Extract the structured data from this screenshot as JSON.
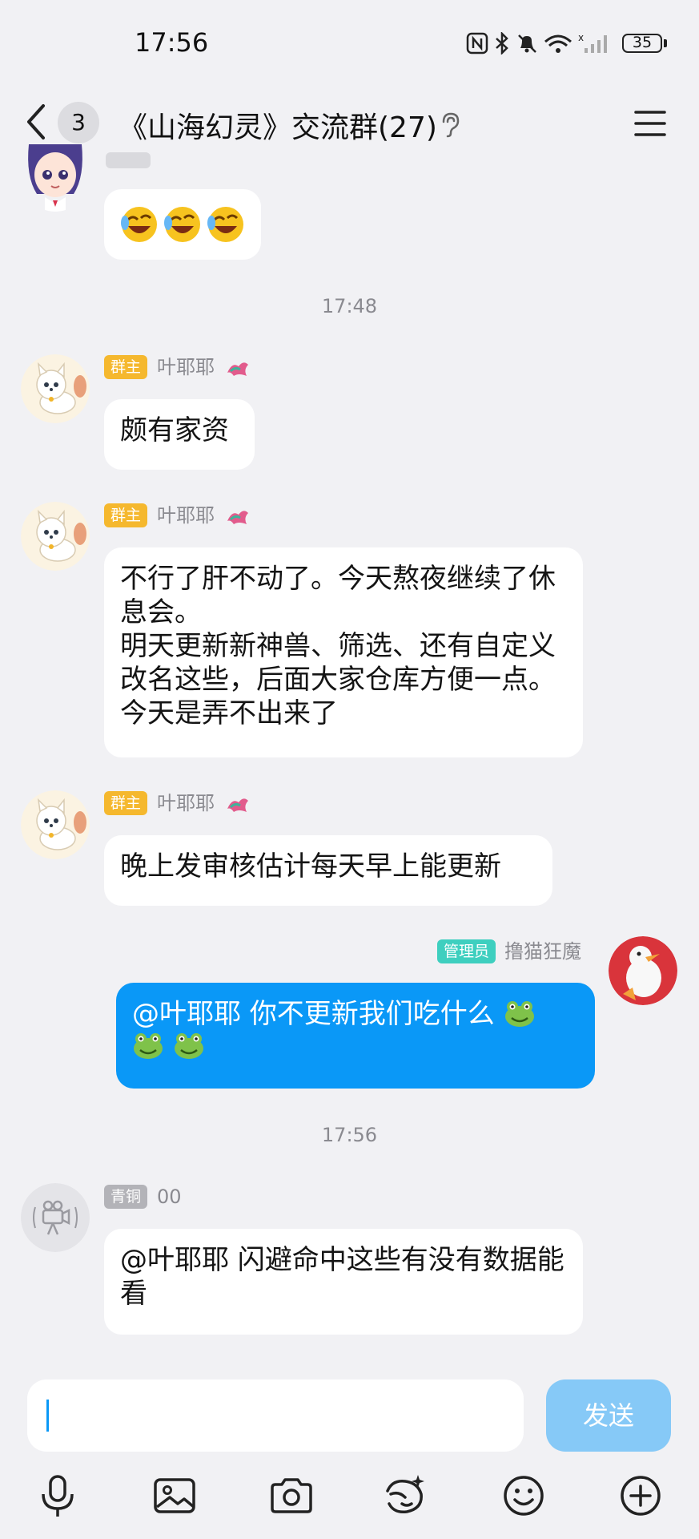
{
  "status_bar": {
    "time": "17:56",
    "battery": "35",
    "icons": [
      "nfc-icon",
      "bluetooth-icon",
      "mute-icon",
      "wifi-icon",
      "signal-icon"
    ]
  },
  "header": {
    "back_icon": "chevron-left-icon",
    "unread_count": "3",
    "title": "《山海幻灵》交流群(27)",
    "listen_icon": "ear-icon",
    "menu_icon": "menu-icon"
  },
  "messages": [
    {
      "type": "emoji",
      "content": "😂😂😂"
    },
    {
      "type": "time",
      "text": "17:48"
    },
    {
      "type": "msg",
      "role": "群主",
      "name": "叶耶耶",
      "text": "颇有家资"
    },
    {
      "type": "msg",
      "role": "群主",
      "name": "叶耶耶",
      "text": "不行了肝不动了。今天熬夜继续了休息会。\n明天更新新神兽、筛选、还有自定义改名这些，后面大家仓库方便一点。今天是弄不出来了"
    },
    {
      "type": "msg",
      "role": "群主",
      "name": "叶耶耶",
      "text": "晚上发审核估计每天早上能更新"
    },
    {
      "type": "self",
      "role": "管理员",
      "name": "撸猫狂魔",
      "text": "@叶耶耶 你不更新我们吃什么"
    },
    {
      "type": "time",
      "text": "17:56"
    },
    {
      "type": "msg",
      "role": "青铜",
      "name": "00",
      "text": "@叶耶耶 闪避命中这些有没有数据能看"
    }
  ],
  "input": {
    "placeholder": "",
    "send_label": "发送"
  },
  "toolbar": [
    "microphone-icon",
    "image-icon",
    "camera-icon",
    "magic-face-icon",
    "emoji-icon",
    "plus-icon"
  ],
  "colors": {
    "accent": "#0a98f7",
    "owner_badge": "#f5b82e",
    "admin_badge": "#3ecfbf",
    "bronze_badge": "#b3b3b8"
  }
}
